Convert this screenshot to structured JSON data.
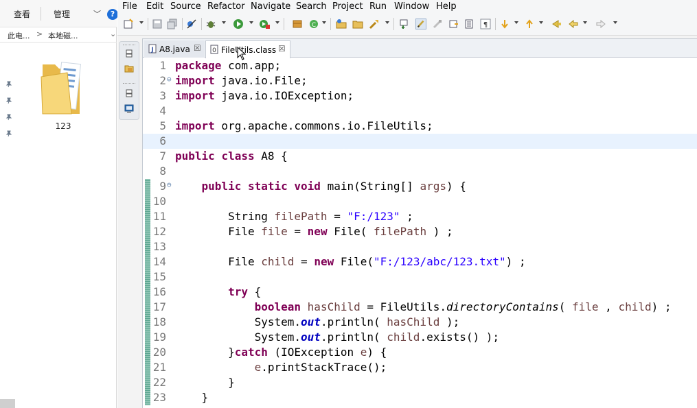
{
  "explorer": {
    "ribbon": {
      "view_tab": "查看",
      "manage_tab": "管理",
      "collapse_chevron": "﹀",
      "help_symbol": "?"
    },
    "address": {
      "crumb_1": "此电...",
      "arrow": ">",
      "crumb_2": "本地磁...",
      "dropdown": "⌄"
    },
    "folder": {
      "name": "123"
    }
  },
  "eclipse": {
    "menu": [
      "File",
      "Edit",
      "Source",
      "Refactor",
      "Navigate",
      "Search",
      "Project",
      "Run",
      "Window",
      "Help"
    ],
    "tabs": [
      {
        "label": "A8.java",
        "close": "☒",
        "active": false
      },
      {
        "label": "FileUtils.class",
        "close": "☒",
        "active": true
      }
    ],
    "code_lines": [
      {
        "n": "1",
        "fold": ""
      },
      {
        "n": "2",
        "fold": "⊖"
      },
      {
        "n": "3",
        "fold": ""
      },
      {
        "n": "4",
        "fold": ""
      },
      {
        "n": "5",
        "fold": ""
      },
      {
        "n": "6",
        "fold": ""
      },
      {
        "n": "7",
        "fold": ""
      },
      {
        "n": "8",
        "fold": ""
      },
      {
        "n": "9",
        "fold": "⊖"
      },
      {
        "n": "10",
        "fold": ""
      },
      {
        "n": "11",
        "fold": ""
      },
      {
        "n": "12",
        "fold": ""
      },
      {
        "n": "13",
        "fold": ""
      },
      {
        "n": "14",
        "fold": ""
      },
      {
        "n": "15",
        "fold": ""
      },
      {
        "n": "16",
        "fold": ""
      },
      {
        "n": "17",
        "fold": ""
      },
      {
        "n": "18",
        "fold": ""
      },
      {
        "n": "19",
        "fold": ""
      },
      {
        "n": "20",
        "fold": ""
      },
      {
        "n": "21",
        "fold": ""
      },
      {
        "n": "22",
        "fold": ""
      },
      {
        "n": "23",
        "fold": ""
      }
    ],
    "code_tokens": {
      "l1": [
        "package",
        " com.app;"
      ],
      "l2": [
        "import",
        " java.io.File;"
      ],
      "l3": [
        "import",
        " java.io.IOException;"
      ],
      "l5": [
        "import",
        " org.apache.commons.io.FileUtils;"
      ],
      "l7": [
        "public",
        " ",
        "class",
        " A8 {"
      ],
      "l9": [
        "    ",
        "public",
        " ",
        "static",
        " ",
        "void",
        " main(String[] ",
        "args",
        ") {"
      ],
      "l11": [
        "        String ",
        "filePath",
        " = ",
        "\"F:/123\"",
        " ;"
      ],
      "l12": [
        "        File ",
        "file",
        " = ",
        "new",
        " File( ",
        "filePath",
        " ) ;"
      ],
      "l14": [
        "        File ",
        "child",
        " = ",
        "new",
        " File(",
        "\"F:/123/abc/123.txt\"",
        ") ;"
      ],
      "l16": [
        "        ",
        "try",
        " {"
      ],
      "l17": [
        "            ",
        "boolean",
        " ",
        "hasChild",
        " = FileUtils.",
        "directoryContains",
        "( ",
        "file",
        " , ",
        "child",
        ") ;"
      ],
      "l18": [
        "            System.",
        "out",
        ".println( ",
        "hasChild",
        " );"
      ],
      "l19": [
        "            System.",
        "out",
        ".println( ",
        "child",
        ".exists() );"
      ],
      "l20": [
        "        }",
        "catch",
        " (IOException ",
        "e",
        ") {"
      ],
      "l21": [
        "            ",
        "e",
        ".printStackTrace();"
      ],
      "l22": [
        "        }"
      ],
      "l23": [
        "    }"
      ]
    }
  }
}
